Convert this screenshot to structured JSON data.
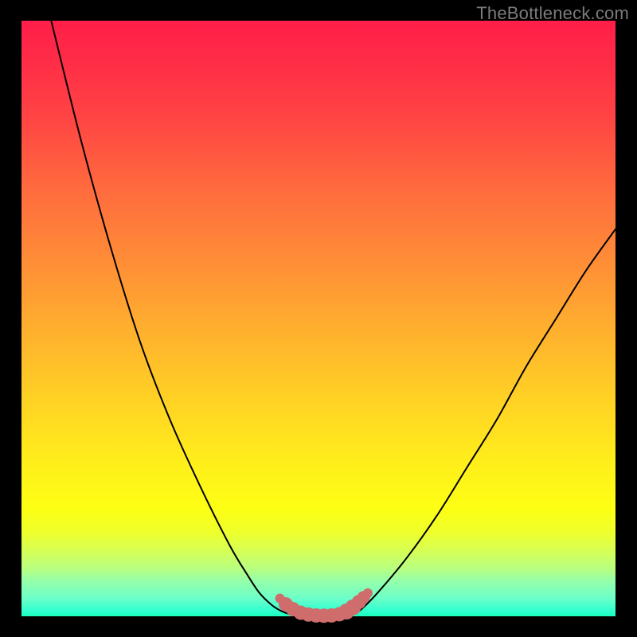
{
  "watermark": {
    "text": "TheBottleneck.com"
  },
  "colors": {
    "background": "#000000",
    "curve": "#000000",
    "marker": "#cf6d6d",
    "gradient_top": "#ff1e49",
    "gradient_bottom": "#1bffbd"
  },
  "chart_data": {
    "type": "line",
    "title": "",
    "xlabel": "",
    "ylabel": "",
    "xlim": [
      0,
      100
    ],
    "ylim": [
      0,
      100
    ],
    "grid": false,
    "legend": false,
    "annotations": [],
    "series": [
      {
        "name": "left-branch",
        "x": [
          5,
          10,
          15,
          20,
          25,
          30,
          35,
          38,
          40,
          42,
          43.5,
          45,
          46.5
        ],
        "y": [
          100,
          80,
          62,
          46,
          33,
          22,
          12,
          7,
          4,
          2,
          1,
          0.4,
          0.2
        ]
      },
      {
        "name": "valley-floor",
        "x": [
          46.5,
          48,
          50,
          52,
          54,
          55.5
        ],
        "y": [
          0.2,
          0.05,
          0,
          0,
          0.05,
          0.2
        ]
      },
      {
        "name": "right-branch",
        "x": [
          55.5,
          57,
          60,
          65,
          70,
          75,
          80,
          85,
          90,
          95,
          100
        ],
        "y": [
          0.2,
          1,
          4,
          10,
          17,
          25,
          33,
          42,
          50,
          58,
          65
        ]
      }
    ],
    "markers": {
      "name": "valley-markers",
      "color": "#cf6d6d",
      "points": [
        {
          "x": 43.5,
          "y": 3.0,
          "r": 6
        },
        {
          "x": 44.5,
          "y": 2.0,
          "r": 9
        },
        {
          "x": 45.7,
          "y": 1.2,
          "r": 9
        },
        {
          "x": 47.0,
          "y": 0.6,
          "r": 9
        },
        {
          "x": 48.3,
          "y": 0.3,
          "r": 9
        },
        {
          "x": 49.6,
          "y": 0.15,
          "r": 9
        },
        {
          "x": 50.9,
          "y": 0.1,
          "r": 9
        },
        {
          "x": 52.2,
          "y": 0.15,
          "r": 9
        },
        {
          "x": 53.5,
          "y": 0.35,
          "r": 9
        },
        {
          "x": 54.7,
          "y": 0.8,
          "r": 10
        },
        {
          "x": 55.8,
          "y": 1.5,
          "r": 10
        },
        {
          "x": 56.8,
          "y": 2.4,
          "r": 9
        },
        {
          "x": 57.6,
          "y": 3.2,
          "r": 8
        },
        {
          "x": 58.3,
          "y": 3.9,
          "r": 6
        }
      ]
    }
  }
}
